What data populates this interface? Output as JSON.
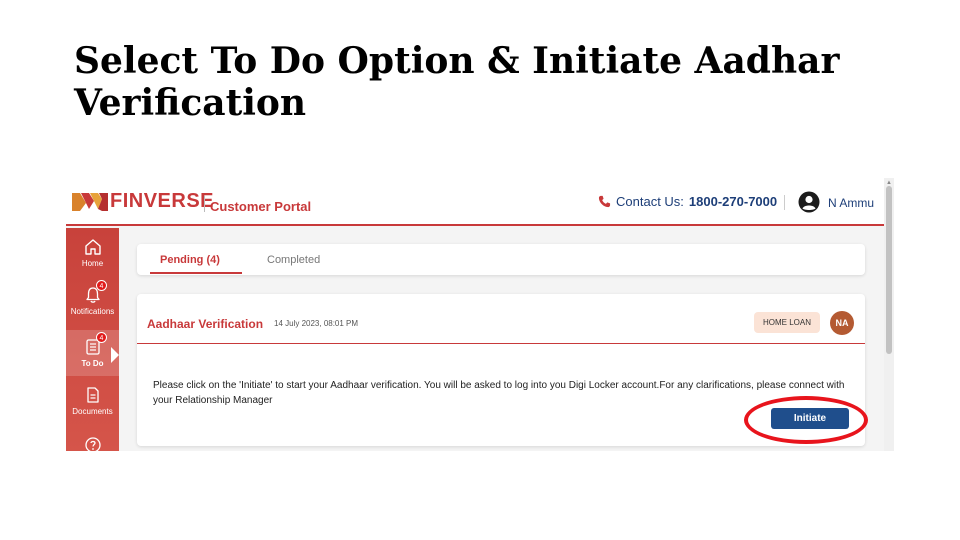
{
  "slide": {
    "title": "Select To Do Option & Initiate Aadhar Verification"
  },
  "header": {
    "brand": "FINVERSE",
    "subtitle": "Customer Portal",
    "contact_label": "Contact Us:",
    "contact_number": "1800-270-7000",
    "user_name": "N Ammu",
    "icons": [
      "finverse-logo",
      "phone-icon",
      "user-account-icon"
    ]
  },
  "sidebar": {
    "items": [
      {
        "label": "Home",
        "icon": "home-icon",
        "badge": ""
      },
      {
        "label": "Notifications",
        "icon": "bell-icon",
        "badge": "4"
      },
      {
        "label": "To Do",
        "icon": "checklist-icon",
        "badge": "4"
      },
      {
        "label": "Documents",
        "icon": "document-icon",
        "badge": ""
      },
      {
        "label": "",
        "icon": "help-icon",
        "badge": ""
      }
    ],
    "active": "To Do"
  },
  "tabs": {
    "pending": "Pending (4)",
    "completed": "Completed"
  },
  "task": {
    "title": "Aadhaar Verification",
    "date": "14 July 2023, 08:01 PM",
    "tag": "HOME LOAN",
    "avatar": "NA",
    "message": "Please click on the 'Initiate' to start your Aadhaar verification. You will be asked to log into you Digi Locker account.For any clarifications, please connect with your Relationship Manager",
    "button": "Initiate"
  },
  "colors": {
    "brand_red": "#c8393a",
    "navy": "#1f4e8c",
    "highlight": "#e8141c"
  }
}
